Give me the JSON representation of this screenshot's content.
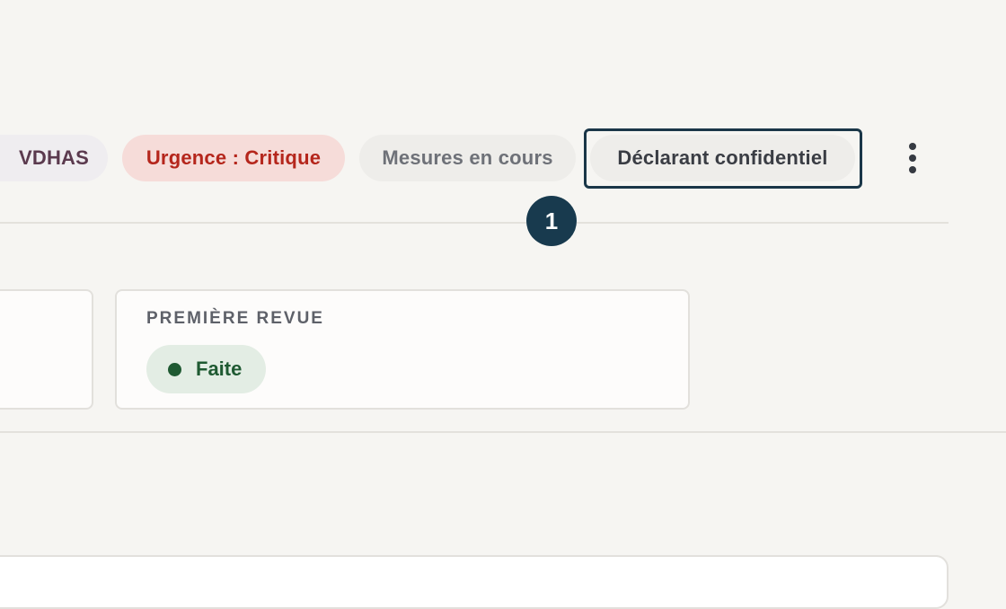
{
  "chips": {
    "vdhas": "VDHAS",
    "urgence": "Urgence : Critique",
    "mesures": "Mesures en cours",
    "declarant": "Déclarant confidentiel"
  },
  "step_badge": "1",
  "more_menu_icon": "kebab-vertical-icon",
  "revue_card": {
    "label": "PREMIÈRE REVUE",
    "status": "Faite"
  },
  "colors": {
    "focus_ring": "#1a3648",
    "urgence_text": "#b5261c",
    "status_green": "#1f5a32"
  }
}
